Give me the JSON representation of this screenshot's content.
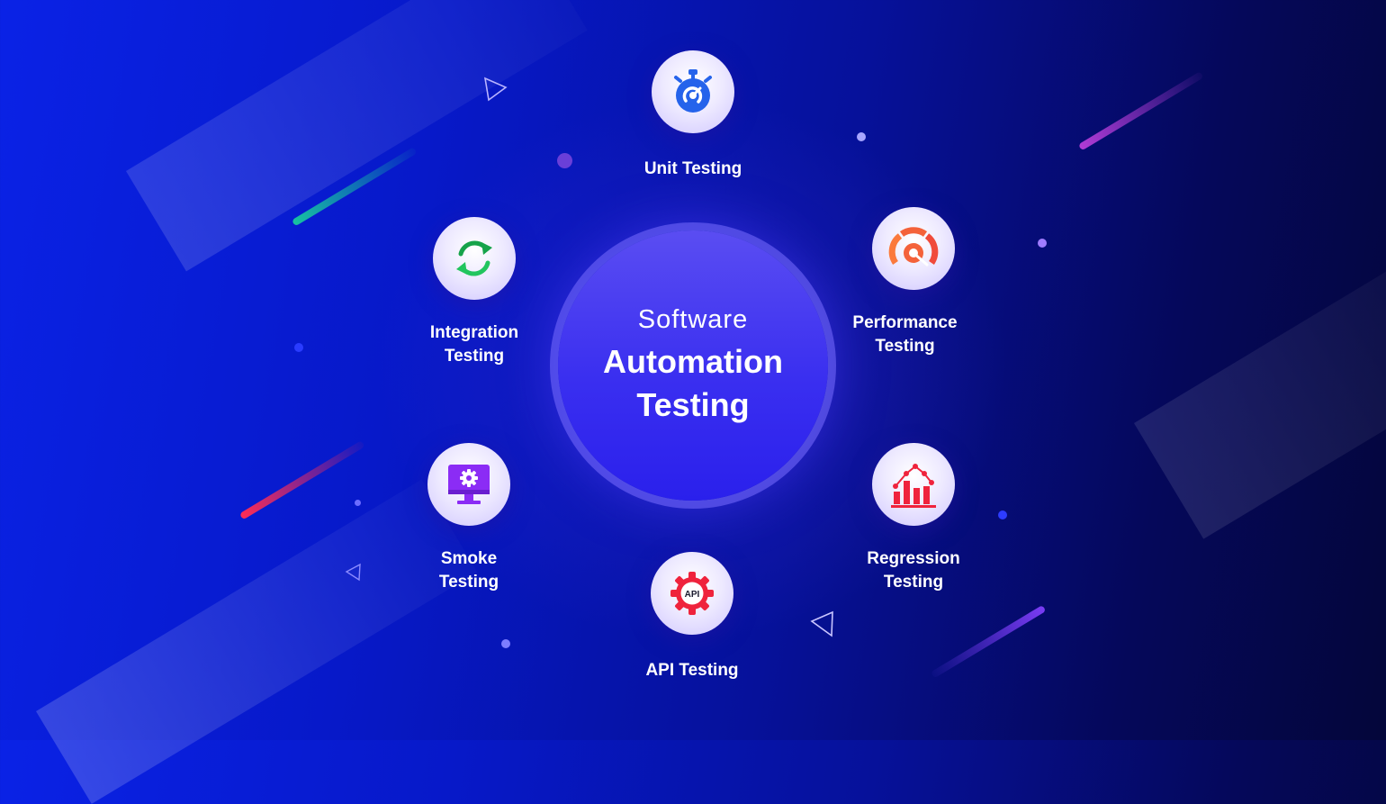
{
  "center": {
    "line1": "Software",
    "line2": "Automation",
    "line3": "Testing"
  },
  "nodes": {
    "unit": {
      "label": "Unit Testing",
      "icon": "stopwatch-icon"
    },
    "performance": {
      "label": "Performance\nTesting",
      "icon": "speedometer-icon"
    },
    "regression": {
      "label": "Regression\nTesting",
      "icon": "bar-chart-icon"
    },
    "api": {
      "label": "API Testing",
      "icon": "api-gear-icon",
      "icon_text": "API"
    },
    "smoke": {
      "label": "Smoke\nTesting",
      "icon": "monitor-gear-icon"
    },
    "integration": {
      "label": "Integration\nTesting",
      "icon": "refresh-icon"
    }
  },
  "colors": {
    "background": "#0a22e6",
    "hub": "#3a2ff0",
    "unit_icon": "#2563eb",
    "performance_icon": "#f4623a",
    "regression_icon": "#ef233c",
    "api_icon": "#ef233c",
    "smoke_icon": "#8b2cf5",
    "integration_icon": "#16a34a"
  }
}
